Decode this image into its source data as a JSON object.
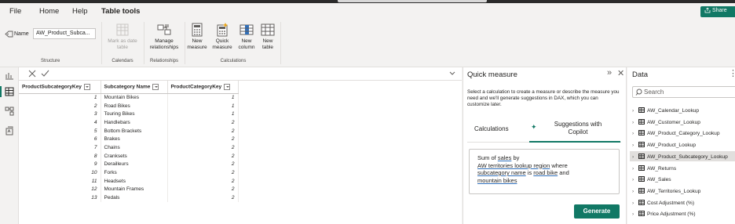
{
  "menu": {
    "file": "File",
    "home": "Home",
    "help": "Help",
    "table_tools": "Table tools",
    "share": "Share"
  },
  "ribbon": {
    "name_label": "Name",
    "name_value": "AW_Product_Subca...",
    "mark_date": "Mark as date table",
    "manage_rel": "Manage relationships",
    "new_measure": "New measure",
    "quick_measure": "Quick measure",
    "new_column": "New column",
    "new_table": "New table",
    "groups": {
      "structure": "Structure",
      "calendars": "Calendars",
      "relationships": "Relationships",
      "calculations": "Calculations"
    }
  },
  "grid": {
    "headers": [
      "ProductSubcategoryKey",
      "Subcategory Name",
      "ProductCategoryKey"
    ],
    "rows": [
      [
        "1",
        "Mountain Bikes",
        "1"
      ],
      [
        "2",
        "Road Bikes",
        "1"
      ],
      [
        "3",
        "Touring Bikes",
        "1"
      ],
      [
        "4",
        "Handlebars",
        "2"
      ],
      [
        "5",
        "Bottom Brackets",
        "2"
      ],
      [
        "6",
        "Brakes",
        "2"
      ],
      [
        "7",
        "Chains",
        "2"
      ],
      [
        "8",
        "Cranksets",
        "2"
      ],
      [
        "9",
        "Derailleurs",
        "2"
      ],
      [
        "10",
        "Forks",
        "2"
      ],
      [
        "11",
        "Headsets",
        "2"
      ],
      [
        "12",
        "Mountain Frames",
        "2"
      ],
      [
        "13",
        "Pedals",
        "2"
      ]
    ]
  },
  "quick_measure": {
    "title": "Quick measure",
    "description": "Select a calculation to create a measure or describe the measure you need and we'll generate suggestions in DAX, which you can customize later.",
    "tab_calculations": "Calculations",
    "tab_suggestions": "Suggestions with Copilot",
    "prompt": {
      "l1a": "Sum of ",
      "l1b": "sales",
      "l1c": " by",
      "l2a": "AW territories lookup region",
      "l2b": " where",
      "l3a": "subcategory name",
      "l3b": " is ",
      "l3c": "road bike",
      "l3d": " and",
      "l4a": "mountain bikes"
    },
    "generate": "Generate"
  },
  "data_panel": {
    "title": "Data",
    "search_placeholder": "Search",
    "items": [
      "AW_Calendar_Lookup",
      "AW_Customer_Lookup",
      "AW_Product_Category_Lookup",
      "AW_Product_Lookup",
      "AW_Product_Subcategory_Lookup",
      "AW_Returns",
      "AW_Sales",
      "AW_Territories_Lookup",
      "Cost Adjustment (%)",
      "Price Adjustment (%)"
    ]
  },
  "colors": {
    "accent": "#117865",
    "selected_row": "#e1dfdd"
  }
}
